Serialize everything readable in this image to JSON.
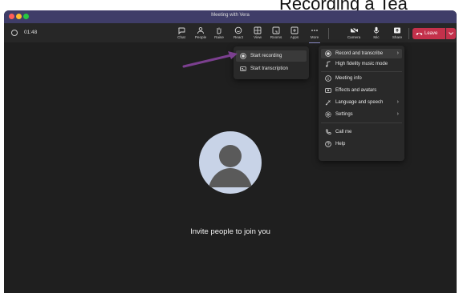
{
  "caption": "Recording a Tea",
  "window": {
    "title": "Meeting with Vera"
  },
  "toolbar": {
    "timer": "01:48",
    "buttons": [
      {
        "key": "chat",
        "label": "Chat",
        "icon": "chat-icon"
      },
      {
        "key": "people",
        "label": "People",
        "icon": "people-icon"
      },
      {
        "key": "raise",
        "label": "Raise",
        "icon": "hand-icon"
      },
      {
        "key": "react",
        "label": "React",
        "icon": "smile-icon"
      },
      {
        "key": "view",
        "label": "View",
        "icon": "grid-icon"
      },
      {
        "key": "rooms",
        "label": "Rooms",
        "icon": "rooms-icon"
      },
      {
        "key": "apps",
        "label": "Apps",
        "icon": "apps-icon"
      },
      {
        "key": "more",
        "label": "More",
        "icon": "more-icon"
      },
      {
        "key": "camera",
        "label": "Camera",
        "icon": "camera-off-icon"
      },
      {
        "key": "mic",
        "label": "Mic",
        "icon": "mic-icon"
      },
      {
        "key": "share",
        "label": "Share",
        "icon": "share-icon"
      }
    ],
    "leave_label": "Leave"
  },
  "more_menu": {
    "items": [
      {
        "label": "Record and transcribe",
        "icon": "record-icon",
        "has_submenu": true,
        "active": true
      },
      {
        "label": "High fidelity music mode",
        "icon": "music-icon",
        "has_submenu": false
      },
      {
        "label": "Meeting info",
        "icon": "info-icon",
        "has_submenu": false
      },
      {
        "label": "Effects and avatars",
        "icon": "effects-icon",
        "has_submenu": false
      },
      {
        "label": "Language and speech",
        "icon": "language-icon",
        "has_submenu": true
      },
      {
        "label": "Settings",
        "icon": "gear-icon",
        "has_submenu": true
      },
      {
        "label": "Call me",
        "icon": "phone-icon",
        "has_submenu": false
      },
      {
        "label": "Help",
        "icon": "help-icon",
        "has_submenu": false
      }
    ]
  },
  "record_submenu": {
    "items": [
      {
        "label": "Start recording",
        "icon": "record-icon"
      },
      {
        "label": "Start transcription",
        "icon": "transcript-icon"
      }
    ]
  },
  "stage": {
    "invite_text": "Invite people to join you"
  },
  "colors": {
    "accent": "#8b8cc7",
    "leave": "#c4314b",
    "titlebar": "#3f3d68",
    "arrow": "#7b3f8f"
  }
}
